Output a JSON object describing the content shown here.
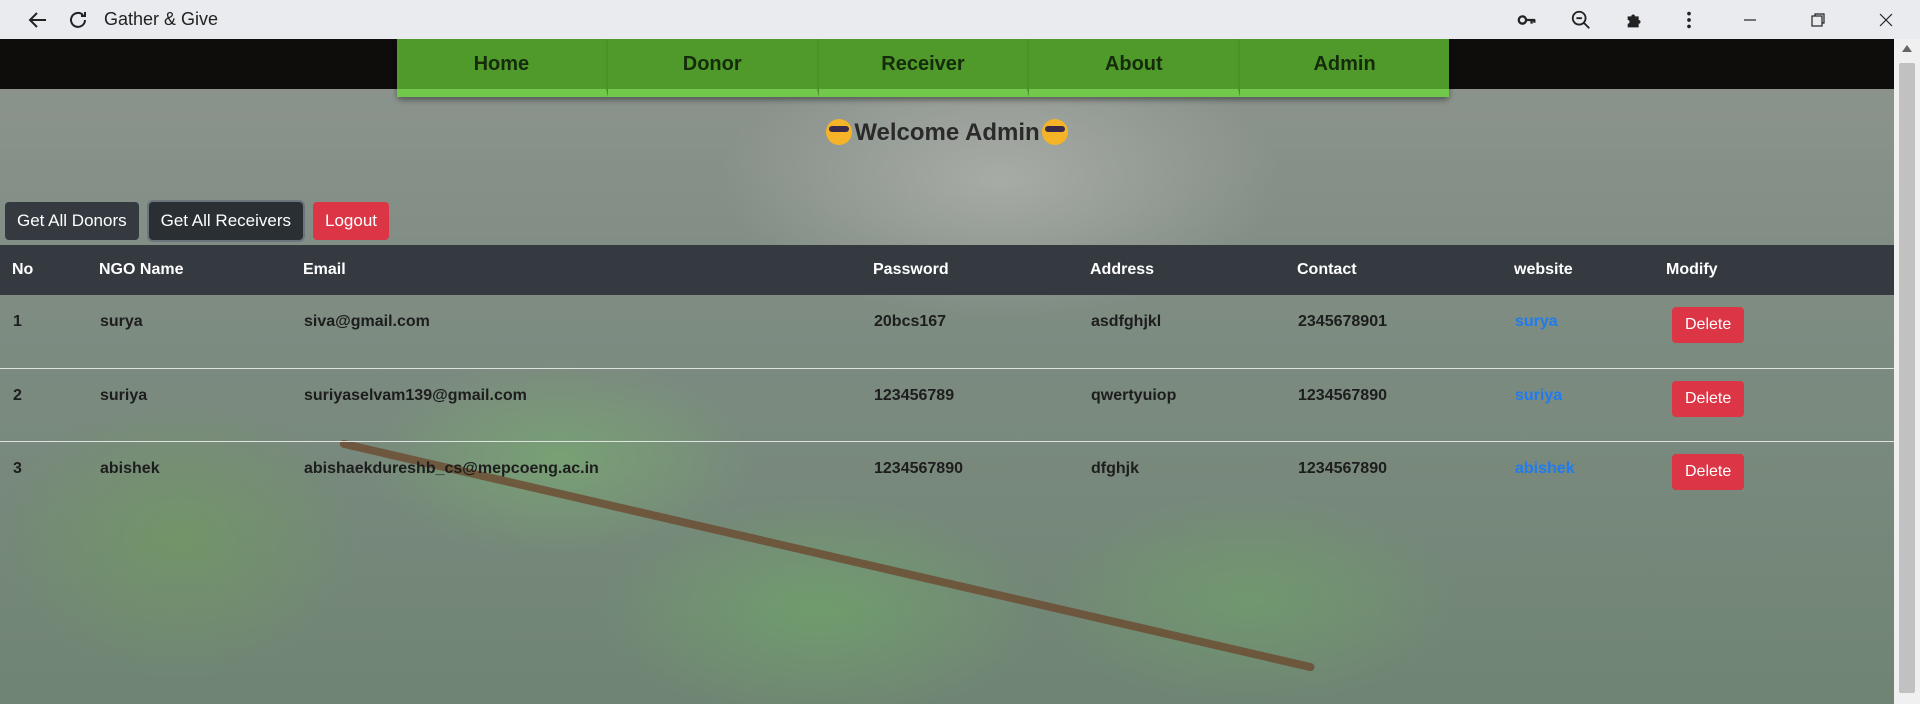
{
  "browser": {
    "title": "Gather & Give",
    "icons": [
      "back-arrow-icon",
      "reload-icon",
      "key-icon",
      "zoom-out-icon",
      "extensions-icon",
      "more-menu-icon",
      "minimize-icon",
      "restore-icon",
      "close-icon"
    ]
  },
  "nav": {
    "items": [
      "Home",
      "Donor",
      "Receiver",
      "About",
      "Admin"
    ],
    "color": "#5aa434"
  },
  "welcome": "Welcome Admin",
  "actions": {
    "get_donors": "Get All Donors",
    "get_receivers": "Get All Receivers",
    "logout": "Logout"
  },
  "table": {
    "headers": [
      "No",
      "NGO Name",
      "Email",
      "Password",
      "Address",
      "Contact",
      "website",
      "Modify"
    ],
    "rows": [
      {
        "no": "1",
        "name": "surya",
        "email": "siva@gmail.com",
        "password": "20bcs167",
        "address": "asdfghjkl",
        "contact": "2345678901",
        "website": "surya",
        "action": "Delete"
      },
      {
        "no": "2",
        "name": "suriya",
        "email": "suriyaselvam139@gmail.com",
        "password": "123456789",
        "address": "qwertyuiop",
        "contact": "1234567890",
        "website": "suriya",
        "action": "Delete"
      },
      {
        "no": "3",
        "name": "abishek",
        "email": "abishaekdureshb_cs@mepcoeng.ac.in",
        "password": "1234567890",
        "address": "dfghjk",
        "contact": "1234567890",
        "website": "abishek",
        "action": "Delete"
      }
    ]
  },
  "colors": {
    "danger": "#dc3545",
    "dark": "#343a40",
    "link": "#1e7cf0"
  }
}
